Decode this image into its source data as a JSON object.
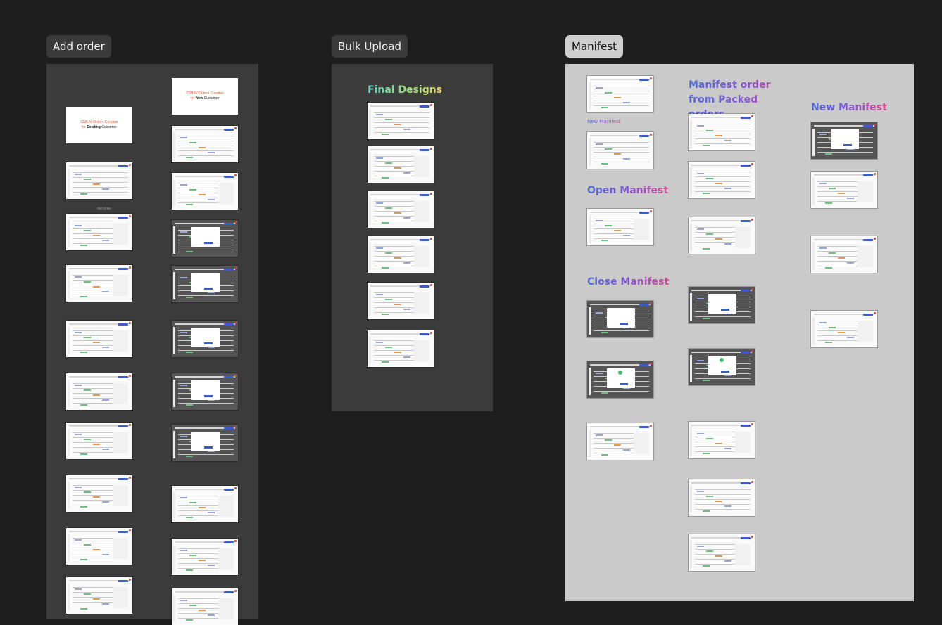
{
  "labels": {
    "add_order": "Add order",
    "bulk_upload": "Bulk Upload",
    "manifest": "Manifest"
  },
  "add_order": {
    "cover1": {
      "line1": "CSB IV Orders Creation",
      "prefix": "for",
      "highlight": "Existing",
      "rest": "Customer"
    },
    "cover2": {
      "line1": "CSB IV Orders Creation",
      "prefix": "for",
      "highlight": "New",
      "rest": "Customer"
    },
    "small_caption": "Add Order"
  },
  "bulk_upload": {
    "title": "Final Designs"
  },
  "manifest": {
    "new_manifest_small": "New Manifest",
    "open_manifest": "Open Manifest",
    "close_manifest": "Close Manifest",
    "from_packed": "Manifest order from Packed orders",
    "new_manifest": "New Manifest"
  },
  "colors": {
    "canvas": "#1e1e1e",
    "frame_dark": "#3b3b3b",
    "frame_light": "#cacaca",
    "accent_blue": "#3b5cc4",
    "accent_red": "#e8502f"
  }
}
